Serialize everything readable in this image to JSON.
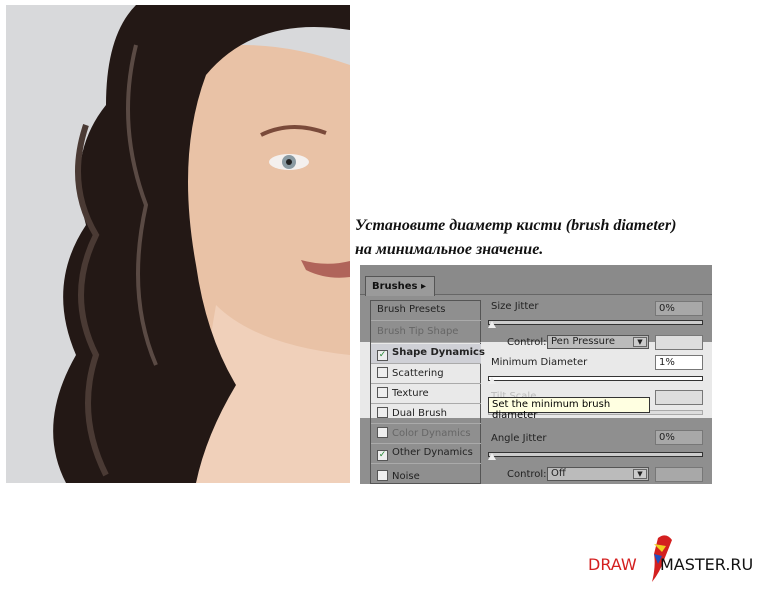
{
  "caption": {
    "line1": "Установите диаметр кисти (brush diameter)",
    "line2": "на минимальное значение."
  },
  "panel": {
    "tab_label": "Brushes",
    "list": [
      {
        "label": "Brush Presets",
        "checkbox": false,
        "checked": false,
        "state": "normal"
      },
      {
        "label": "Brush Tip Shape",
        "checkbox": false,
        "checked": false,
        "state": "faded"
      },
      {
        "label": "Shape Dynamics",
        "checkbox": true,
        "checked": true,
        "state": "selected"
      },
      {
        "label": "Scattering",
        "checkbox": true,
        "checked": false,
        "state": "normal"
      },
      {
        "label": "Texture",
        "checkbox": true,
        "checked": false,
        "state": "normal"
      },
      {
        "label": "Dual Brush",
        "checkbox": true,
        "checked": false,
        "state": "normal"
      },
      {
        "label": "Color Dynamics",
        "checkbox": true,
        "checked": false,
        "state": "faded"
      },
      {
        "label": "Other Dynamics",
        "checkbox": true,
        "checked": true,
        "state": "normal"
      },
      {
        "label": "Noise",
        "checkbox": true,
        "checked": false,
        "state": "normal"
      }
    ],
    "size_jitter": {
      "label": "Size Jitter",
      "value": "0%"
    },
    "control1": {
      "label": "Control:",
      "value": "Pen Pressure"
    },
    "min_diameter": {
      "label": "Minimum Diameter",
      "value": "1%"
    },
    "tilt_scale": {
      "label": "Tilt Scale"
    },
    "tooltip": "Set the minimum brush diameter",
    "angle_jitter": {
      "label": "Angle Jitter",
      "value": "0%"
    },
    "control2": {
      "label": "Control:",
      "value": "Off"
    }
  },
  "logo": {
    "part1": "DRAW",
    "part2": "MASTER.RU",
    "color1": "#d42020",
    "color2": "#111111"
  }
}
